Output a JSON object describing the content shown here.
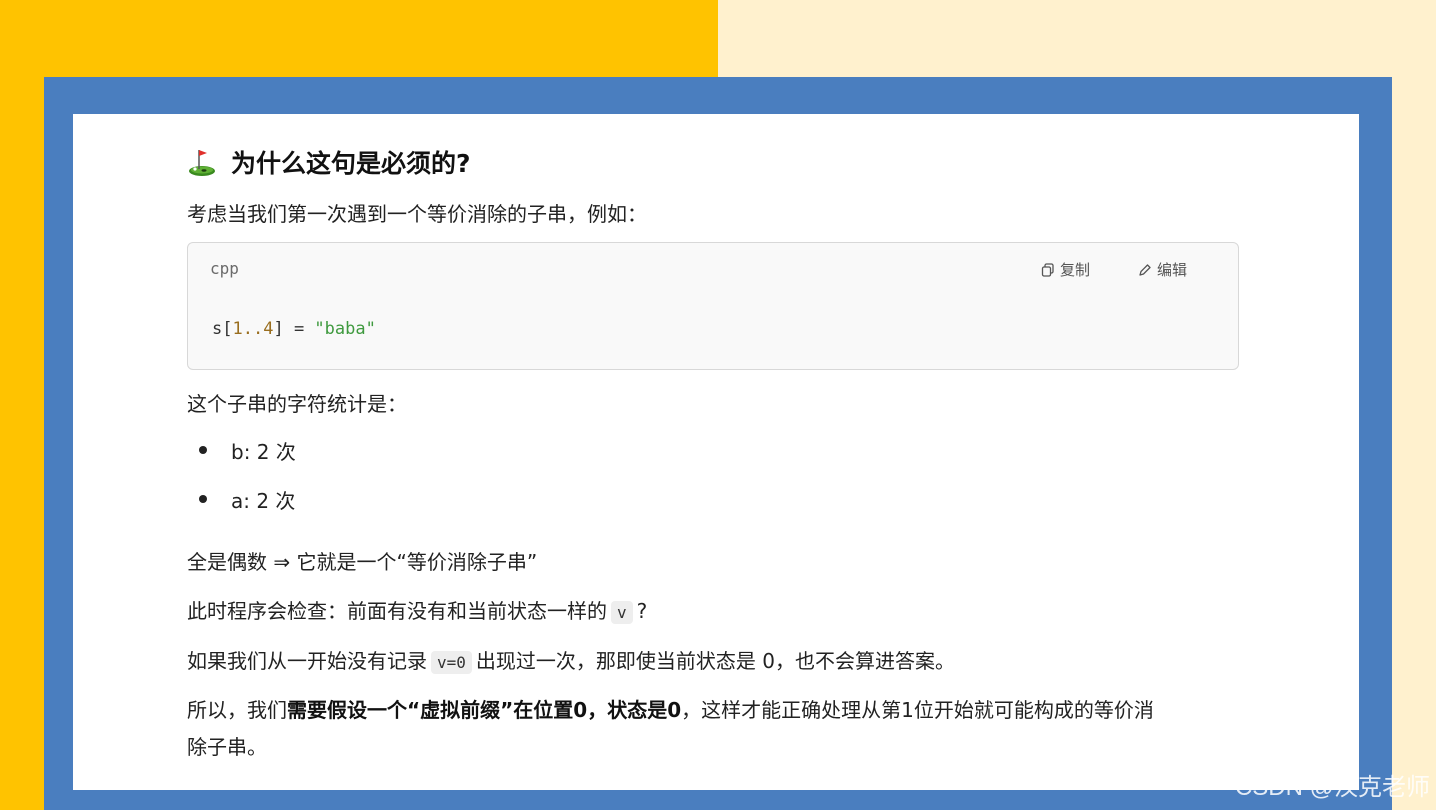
{
  "heading": "为什么这句是必须的?",
  "intro": "考虑当我们第一次遇到一个等价消除的子串，例如：",
  "code": {
    "lang": "cpp",
    "copy_label": "复制",
    "edit_label": "编辑",
    "tokens": {
      "a": "s[",
      "b": "1",
      "c": "..",
      "d": "4",
      "e": "] = ",
      "f": "\"baba\""
    }
  },
  "stats_intro": "这个子串的字符统计是：",
  "bullets": [
    "b: 2 次",
    "a: 2 次"
  ],
  "line_even": "全是偶数 ⇒ 它就是一个“等价消除子串”",
  "line_check": {
    "pre": "此时程序会检查：前面有没有和当前状态一样的",
    "code": "v",
    "post": "?"
  },
  "line_record": {
    "pre": "如果我们从一开始没有记录",
    "code": "v=0",
    "post": "出现过一次，那即使当前状态是 0，也不会算进答案。"
  },
  "conclusion": {
    "pre": "所以，我们",
    "bold": "需要假设一个“虚拟前缀”在位置0，状态是0",
    "post1": "，这样才能正确处理从第1位开始就可能构成的等价消",
    "post2": "除子串。"
  },
  "watermark": "CSDN @汉克老师",
  "colors": {
    "yellow": "#FFC300",
    "cream": "#FFF1CE",
    "blue_frame": "#4A7EBF"
  }
}
